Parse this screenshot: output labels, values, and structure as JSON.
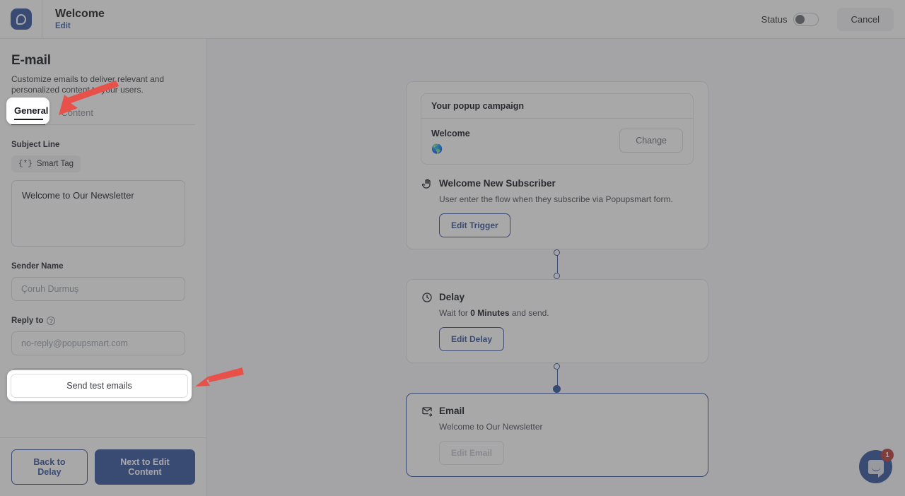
{
  "header": {
    "logo_icon": "popupsmart-logo-icon",
    "title": "Welcome",
    "edit_link": "Edit",
    "status_label": "Status",
    "status_on": false,
    "cancel_label": "Cancel"
  },
  "left_panel": {
    "title": "E-mail",
    "subtitle": "Customize emails to deliver relevant and personalized content to your users.",
    "tabs": [
      {
        "label": "General",
        "active": true
      },
      {
        "label": "Content",
        "active": false
      }
    ],
    "subject_line_label": "Subject Line",
    "smart_tag_label": "Smart Tag",
    "smart_tag_icon": "code-braces-icon",
    "subject_value": "Welcome to Our Newsletter",
    "sender_name_label": "Sender Name",
    "sender_name_placeholder": "Çoruh Durmuş",
    "reply_to_label": "Reply to",
    "reply_to_help_icon": "question-mark-icon",
    "reply_to_placeholder": "no-reply@popupsmart.com",
    "send_test_label": "Send test emails",
    "back_button": "Back to Delay",
    "next_button": "Next to Edit Content"
  },
  "flow": {
    "popup_card": {
      "header": "Your popup campaign",
      "name": "Welcome",
      "globe_icon": "globe-icon",
      "change_label": "Change"
    },
    "trigger": {
      "icon": "click-hand-icon",
      "title": "Welcome New Subscriber",
      "description": "User enter the flow when they subscribe via Popupsmart form.",
      "button": "Edit Trigger"
    },
    "delay": {
      "icon": "clock-icon",
      "title": "Delay",
      "desc_prefix": "Wait for ",
      "desc_value": "0 Minutes",
      "desc_suffix": " and send.",
      "button": "Edit Delay"
    },
    "email": {
      "icon": "envelope-icon",
      "title": "Email",
      "description": "Welcome to Our Newsletter",
      "button": "Edit Email",
      "selected": true
    }
  },
  "intercom": {
    "icon": "chat-bubble-icon",
    "badge": "1"
  },
  "colors": {
    "brand_blue": "#33529b",
    "arrow_red": "#e8504a",
    "overlay": "rgba(66,66,68,0.46)",
    "badge_red": "#b83c38"
  },
  "annotations": [
    {
      "name": "arrow-to-general-tab",
      "points_to": "General tab"
    },
    {
      "name": "arrow-to-send-test-emails",
      "points_to": "Send test emails button"
    }
  ]
}
